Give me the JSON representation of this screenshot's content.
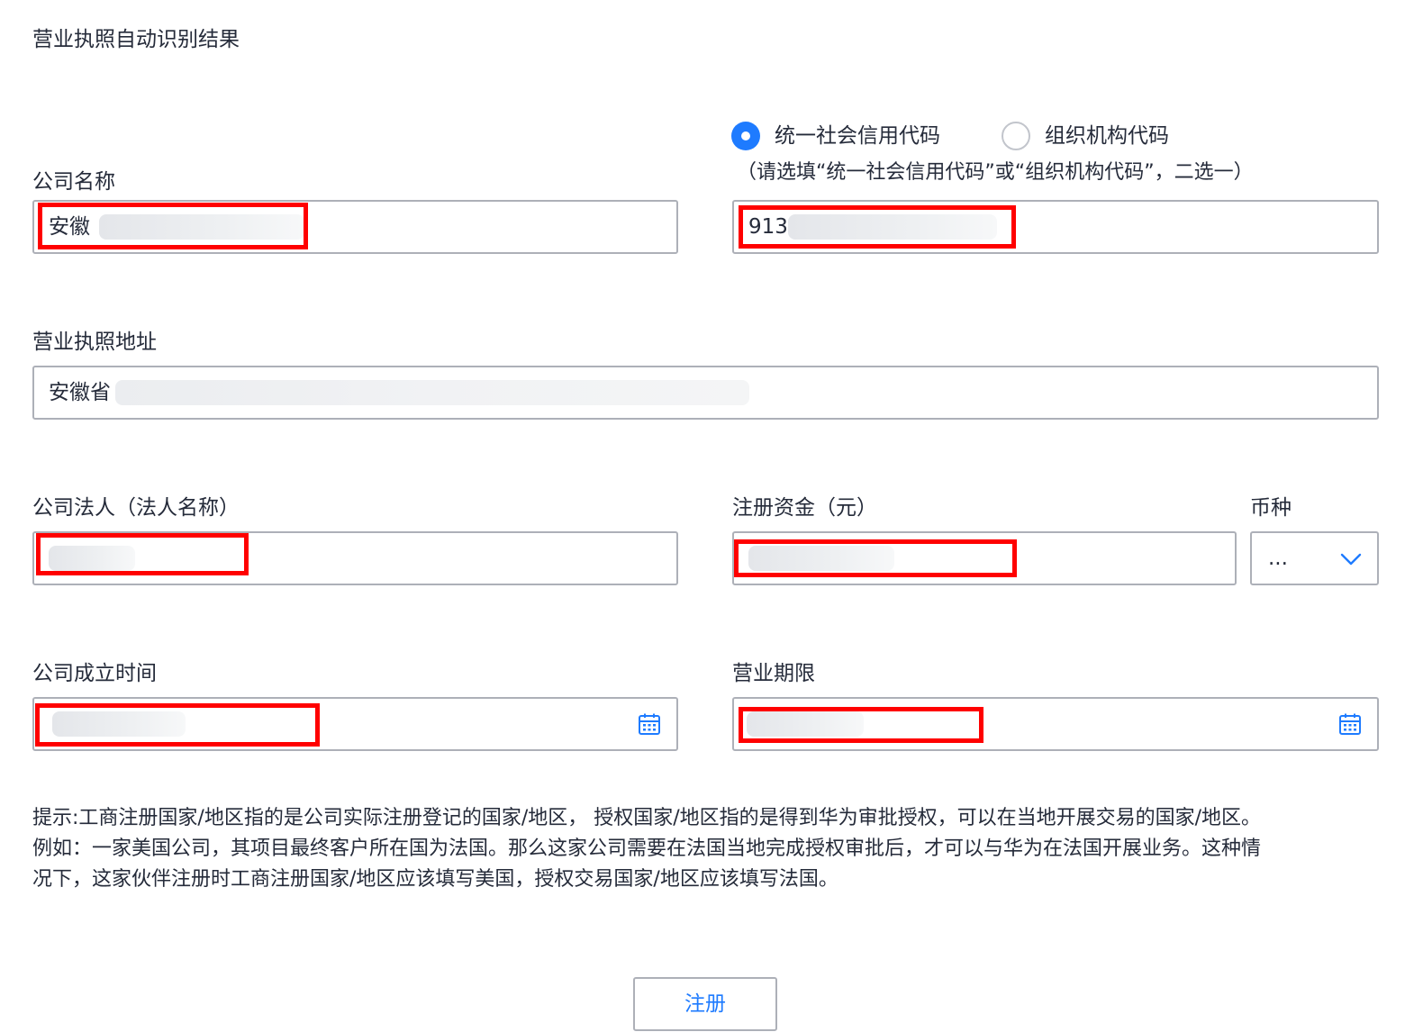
{
  "page": {
    "title": "营业执照自动识别结果"
  },
  "company_name": {
    "label": "公司名称",
    "value": "安徽"
  },
  "code_type": {
    "options": [
      {
        "label": "统一社会信用代码",
        "selected": true
      },
      {
        "label": "组织机构代码",
        "selected": false
      }
    ],
    "note": "（请选填“统一社会信用代码”或“组织机构代码”，二选一）",
    "value": "913"
  },
  "address": {
    "label": "营业执照地址",
    "value": "安徽省"
  },
  "legal_person": {
    "label": "公司法人（法人名称）",
    "value": ""
  },
  "capital": {
    "label": "注册资金（元）",
    "value": ""
  },
  "currency": {
    "label": "币种",
    "value": "..."
  },
  "founded": {
    "label": "公司成立时间",
    "value": ""
  },
  "term": {
    "label": "营业期限",
    "value": ""
  },
  "hint": {
    "lines": [
      "提示:工商注册国家/地区指的是公司实际注册登记的国家/地区，  授权国家/地区指的是得到华为审批授权，可以在当地开展交易的国家/地区。",
      "例如：一家美国公司，其项目最终客户所在国为法国。那么这家公司需要在法国当地完成授权审批后，才可以与华为在法国开展业务。这种情",
      "况下，这家伙伴注册时工商注册国家/地区应该填写美国，授权交易国家/地区应该填写法国。"
    ]
  },
  "submit": {
    "label": "注册"
  },
  "colors": {
    "accent": "#1e7bff",
    "redaction_box": "#ff0000",
    "border": "#adb0b8"
  },
  "icons": {
    "calendar": "calendar-icon",
    "chevron": "chevron-down-icon"
  }
}
